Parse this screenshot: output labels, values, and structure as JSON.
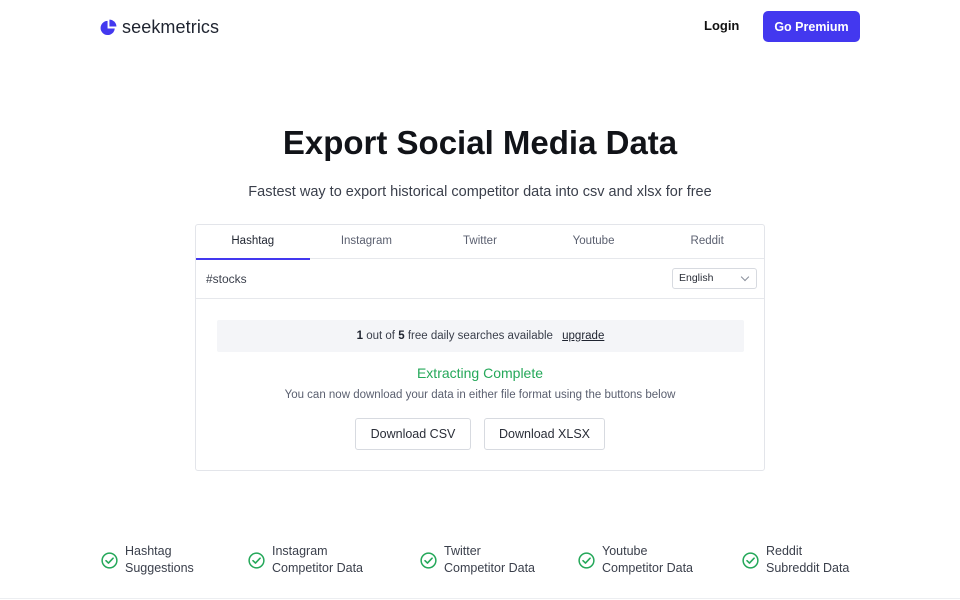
{
  "brand": {
    "name": "seekmetrics",
    "color": "#4338ef"
  },
  "header": {
    "login_label": "Login",
    "premium_label": "Go Premium"
  },
  "hero": {
    "title": "Export Social Media Data",
    "subtitle": "Fastest way to export historical competitor data into csv and xlsx for free"
  },
  "tabs": [
    {
      "label": "Hashtag",
      "active": true
    },
    {
      "label": "Instagram",
      "active": false
    },
    {
      "label": "Twitter",
      "active": false
    },
    {
      "label": "Youtube",
      "active": false
    },
    {
      "label": "Reddit",
      "active": false
    }
  ],
  "search": {
    "value": "#stocks",
    "language": "English"
  },
  "banner": {
    "used": "1",
    "middle": "out of",
    "total": "5",
    "suffix": "free daily searches available",
    "link": "upgrade"
  },
  "status": {
    "title": "Extracting Complete",
    "description": "You can now download your data in either file format using the buttons below",
    "color": "#25a85a"
  },
  "downloads": {
    "csv_label": "Download CSV",
    "xlsx_label": "Download XLSX"
  },
  "features": [
    {
      "line1": "Hashtag",
      "line2": "Suggestions",
      "icon": "check-circle-icon"
    },
    {
      "line1": "Instagram",
      "line2": "Competitor Data",
      "icon": "check-circle-icon"
    },
    {
      "line1": "Twitter",
      "line2": "Competitor Data",
      "icon": "check-circle-icon"
    },
    {
      "line1": "Youtube",
      "line2": "Competitor Data",
      "icon": "check-circle-icon"
    },
    {
      "line1": "Reddit",
      "line2": "Subreddit Data",
      "icon": "check-circle-icon"
    }
  ]
}
